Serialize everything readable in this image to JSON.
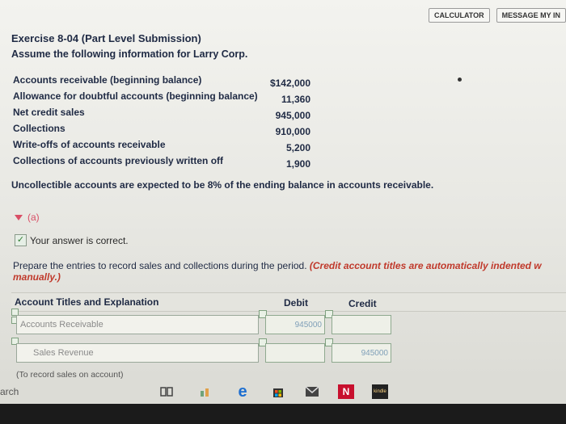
{
  "toolbar": {
    "calculator": "CALCULATOR",
    "message": "MESSAGE MY IN"
  },
  "exercise": {
    "title": "Exercise 8-04 (Part Level Submission)",
    "intro": "Assume the following information for Larry Corp."
  },
  "info": {
    "items": [
      {
        "label": "Accounts receivable (beginning balance)",
        "value": "$142,000"
      },
      {
        "label": "Allowance for doubtful accounts (beginning balance)",
        "value": "11,360"
      },
      {
        "label": "Net credit sales",
        "value": "945,000"
      },
      {
        "label": "Collections",
        "value": "910,000"
      },
      {
        "label": "Write-offs of accounts receivable",
        "value": "5,200"
      },
      {
        "label": "Collections of accounts previously written off",
        "value": "1,900"
      }
    ]
  },
  "statement": "Uncollectible accounts are expected to be 8% of the ending balance in accounts receivable.",
  "part": {
    "label": "(a)",
    "status": "Your answer is correct."
  },
  "instructions": {
    "text": "Prepare the entries to record sales and collections during the period. ",
    "note": "(Credit account titles are automatically indented w manually.)"
  },
  "table": {
    "headers": {
      "account": "Account Titles and Explanation",
      "debit": "Debit",
      "credit": "Credit"
    },
    "rows": [
      {
        "account": "Accounts Receivable",
        "debit": "945000",
        "credit": ""
      },
      {
        "account": "Sales Revenue",
        "debit": "",
        "credit": "945000"
      }
    ],
    "explanation": "(To record sales on account)"
  },
  "taskbar": {
    "search": "arch",
    "n_label": "N",
    "app_label": "kindle"
  }
}
